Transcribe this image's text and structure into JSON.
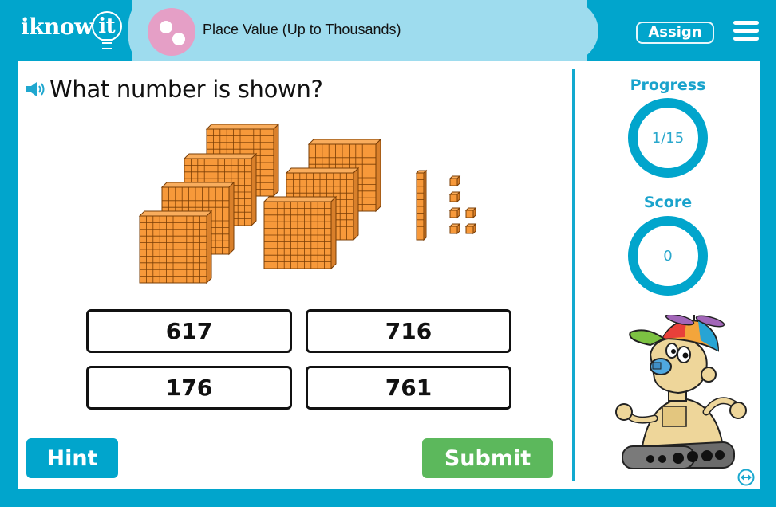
{
  "header": {
    "logo_text": "iknow",
    "logo_bulb_text": "it",
    "topic_title": "Place Value (Up to Thousands)",
    "assign_label": "Assign",
    "icons": {
      "topic": "topic-dots-icon",
      "menu": "hamburger-menu-icon"
    }
  },
  "question": {
    "text": "What number is shown?",
    "icon": "speaker-icon"
  },
  "blocks": {
    "hundreds": 7,
    "tens": 1,
    "ones": 6
  },
  "answers": [
    {
      "label": "617"
    },
    {
      "label": "716"
    },
    {
      "label": "176"
    },
    {
      "label": "761"
    }
  ],
  "buttons": {
    "hint_label": "Hint",
    "submit_label": "Submit"
  },
  "sidebar": {
    "progress_label": "Progress",
    "progress_value": "1/15",
    "score_label": "Score",
    "score_value": "0",
    "mascot": "robot-mascot",
    "swap_icon": "swap-arrows-icon"
  },
  "colors": {
    "frame": "#01a5cc",
    "title_pill": "#9edcee",
    "topic_icon": "#e59fc6",
    "submit": "#5cb85c",
    "block_fill": "#f7993a"
  }
}
